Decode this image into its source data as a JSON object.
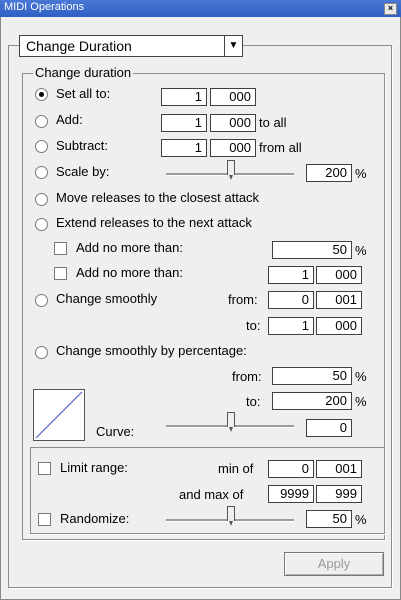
{
  "window": {
    "title": "MIDI Operations",
    "close_glyph": "×"
  },
  "operation_select": {
    "value": "Change Duration",
    "arrow": "▼"
  },
  "group": {
    "label": "Change duration"
  },
  "set_all": {
    "label": "Set all to:",
    "a": "1",
    "b": "000"
  },
  "add": {
    "label": "Add:",
    "a": "1",
    "b": "000",
    "suffix": "to all"
  },
  "subtract": {
    "label": "Subtract:",
    "a": "1",
    "b": "000",
    "suffix": "from all"
  },
  "scale": {
    "label": "Scale by:",
    "value": "200",
    "unit": "%",
    "slider_level": 0.5
  },
  "move_releases": {
    "label": "Move releases to the closest attack"
  },
  "extend_releases": {
    "label": "Extend releases to the next attack"
  },
  "add_no_more_1": {
    "label": "Add no more than:",
    "value": "50",
    "unit": "%"
  },
  "add_no_more_2": {
    "label": "Add no more than:",
    "a": "1",
    "b": "000"
  },
  "change_smoothly": {
    "label": "Change smoothly",
    "from_label": "from:",
    "from_a": "0",
    "from_b": "001",
    "to_label": "to:",
    "to_a": "1",
    "to_b": "000"
  },
  "change_smoothly_pct": {
    "label": "Change smoothly by percentage:",
    "from_label": "from:",
    "from_value": "50",
    "from_unit": "%",
    "to_label": "to:",
    "to_value": "200",
    "to_unit": "%"
  },
  "curve": {
    "label": "Curve:",
    "value": "0",
    "slider_level": 0.5
  },
  "limit_range": {
    "label": "Limit range:",
    "min_label": "min of",
    "min_a": "0",
    "min_b": "001",
    "max_label": "and max of",
    "max_a": "9999",
    "max_b": "999"
  },
  "randomize": {
    "label": "Randomize:",
    "value": "50",
    "unit": "%",
    "slider_level": 0.5
  },
  "apply_button": {
    "label": "Apply"
  },
  "colors": {
    "titlebar": "#2f5fc4",
    "background": "#efefef"
  }
}
